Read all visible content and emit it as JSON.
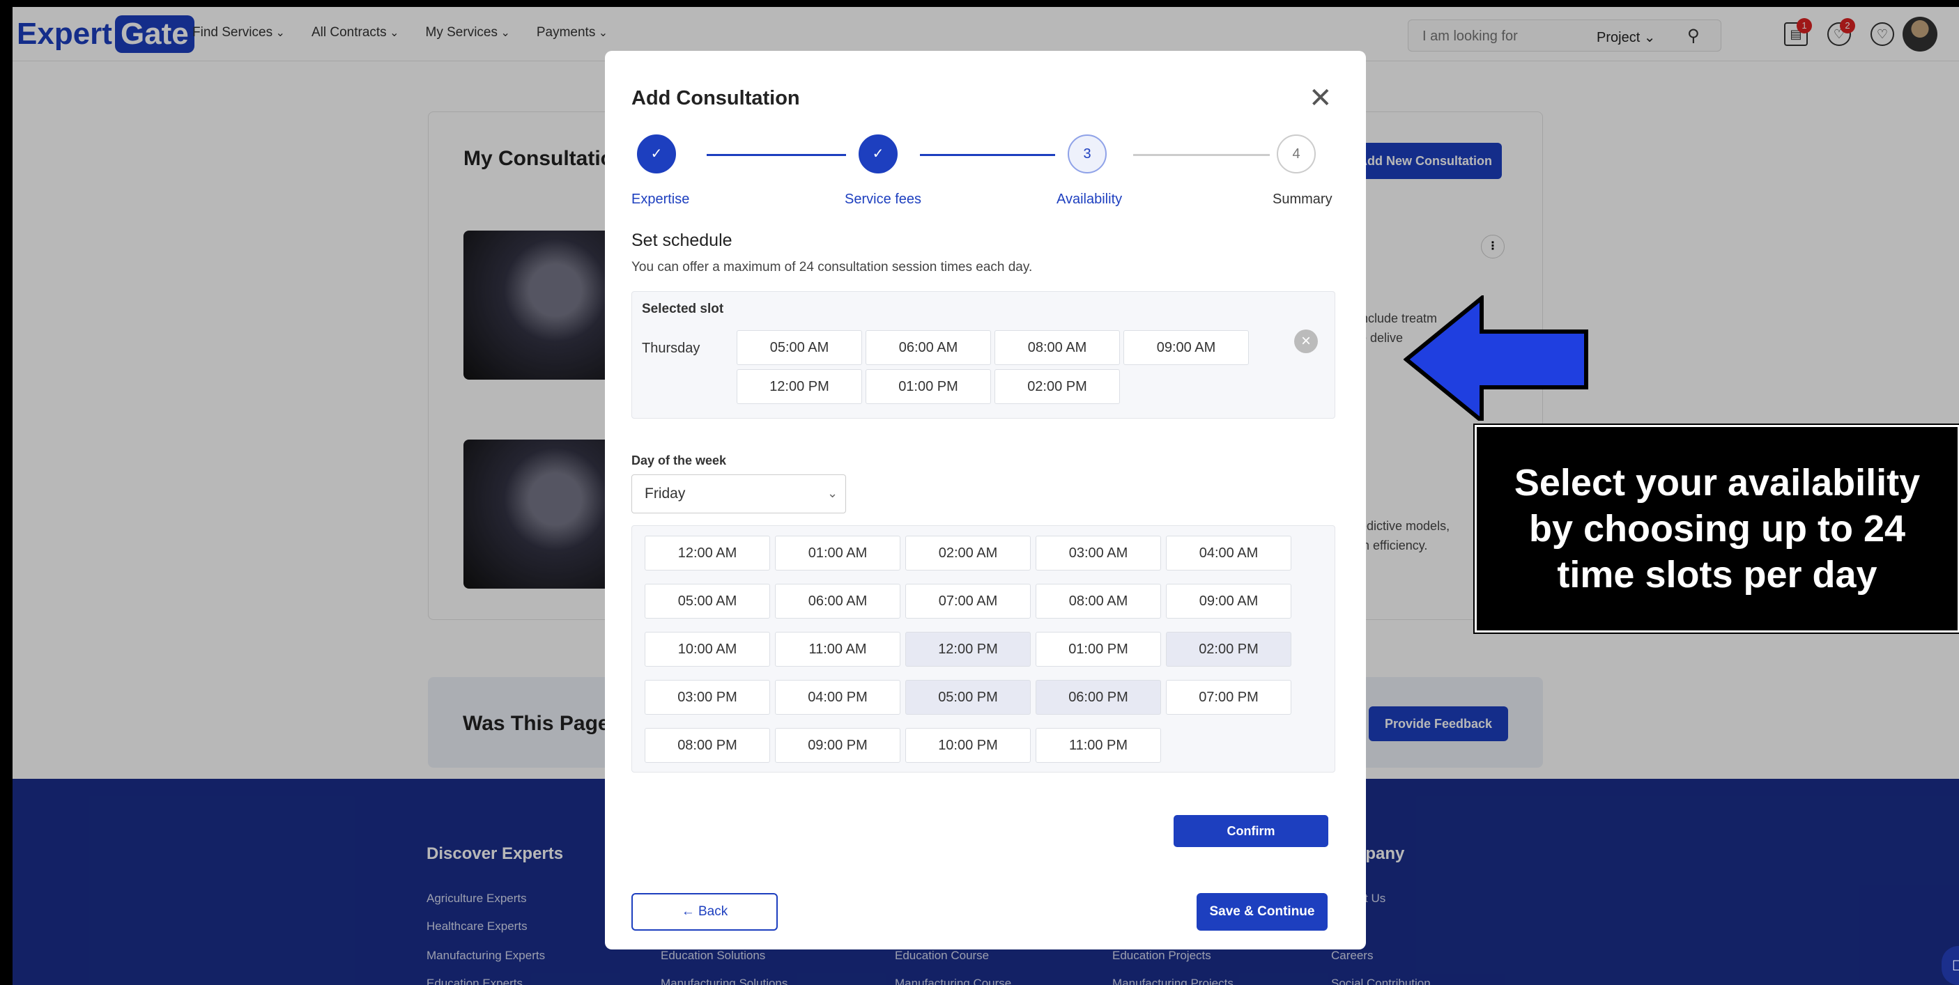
{
  "header": {
    "logo_expert": "Expert",
    "logo_gate": "Gate",
    "nav": [
      "Find Services",
      "All Contracts",
      "My Services",
      "Payments"
    ],
    "search_placeholder": "I am looking for",
    "search_category": "Project",
    "badges": {
      "messages": "1",
      "notifications": "2"
    }
  },
  "background": {
    "card_title": "My Consultations",
    "add_button": "Add New Consultation",
    "item1_text": [
      "s include treatm",
      "are delive"
    ],
    "item2_text": [
      "predictive models,",
      "tem efficiency."
    ],
    "feedback_title": "Was This Page Useful?",
    "feedback_button": "Provide Feedback"
  },
  "footer": {
    "discover_title": "Discover Experts",
    "company_title": "mpany",
    "discover_links": [
      "Agriculture Experts",
      "Healthcare Experts",
      "Manufacturing Experts",
      "Education Experts"
    ],
    "col2_links": [
      "Education Solutions",
      "Manufacturing Solutions"
    ],
    "col3_links": [
      "Education Course",
      "Manufacturing Course"
    ],
    "col4_links": [
      "Education Projects",
      "Manufacturing Projects"
    ],
    "company_links": [
      "t Us",
      "Careers",
      "Social Contribution"
    ]
  },
  "modal": {
    "title": "Add Consultation",
    "steps": [
      {
        "label": "Expertise",
        "state": "done",
        "symbol": "✓"
      },
      {
        "label": "Service fees",
        "state": "done",
        "symbol": "✓"
      },
      {
        "label": "Availability",
        "state": "current",
        "symbol": "3"
      },
      {
        "label": "Summary",
        "state": "todo",
        "symbol": "4"
      }
    ],
    "schedule_title": "Set schedule",
    "schedule_sub": "You can offer a maximum of 24 consultation session times each day.",
    "selected_label": "Selected slot",
    "selected_day": "Thursday",
    "selected_slots": [
      "05:00 AM",
      "06:00 AM",
      "08:00 AM",
      "09:00 AM",
      "12:00 PM",
      "01:00 PM",
      "02:00 PM"
    ],
    "dow_label": "Day of the week",
    "dow_value": "Friday",
    "time_slots": [
      {
        "t": "12:00 AM",
        "on": false
      },
      {
        "t": "01:00 AM",
        "on": false
      },
      {
        "t": "02:00 AM",
        "on": false
      },
      {
        "t": "03:00 AM",
        "on": false
      },
      {
        "t": "04:00 AM",
        "on": false
      },
      {
        "t": "05:00 AM",
        "on": false
      },
      {
        "t": "06:00 AM",
        "on": false
      },
      {
        "t": "07:00 AM",
        "on": false
      },
      {
        "t": "08:00 AM",
        "on": false
      },
      {
        "t": "09:00 AM",
        "on": false
      },
      {
        "t": "10:00 AM",
        "on": false
      },
      {
        "t": "11:00 AM",
        "on": false
      },
      {
        "t": "12:00 PM",
        "on": true
      },
      {
        "t": "01:00 PM",
        "on": false
      },
      {
        "t": "02:00 PM",
        "on": true
      },
      {
        "t": "03:00 PM",
        "on": false
      },
      {
        "t": "04:00 PM",
        "on": false
      },
      {
        "t": "05:00 PM",
        "on": true
      },
      {
        "t": "06:00 PM",
        "on": true
      },
      {
        "t": "07:00 PM",
        "on": false
      },
      {
        "t": "08:00 PM",
        "on": false
      },
      {
        "t": "09:00 PM",
        "on": false
      },
      {
        "t": "10:00 PM",
        "on": false
      },
      {
        "t": "11:00 PM",
        "on": false
      }
    ],
    "confirm": "Confirm",
    "back": "← Back",
    "save": "Save & Continue"
  },
  "callout": {
    "text": "Select your availability by choosing up to 24 time slots per day"
  },
  "colors": {
    "brand": "#1d3fbf",
    "footer": "#1b2f8c",
    "arrow": "#1f3fe0"
  }
}
